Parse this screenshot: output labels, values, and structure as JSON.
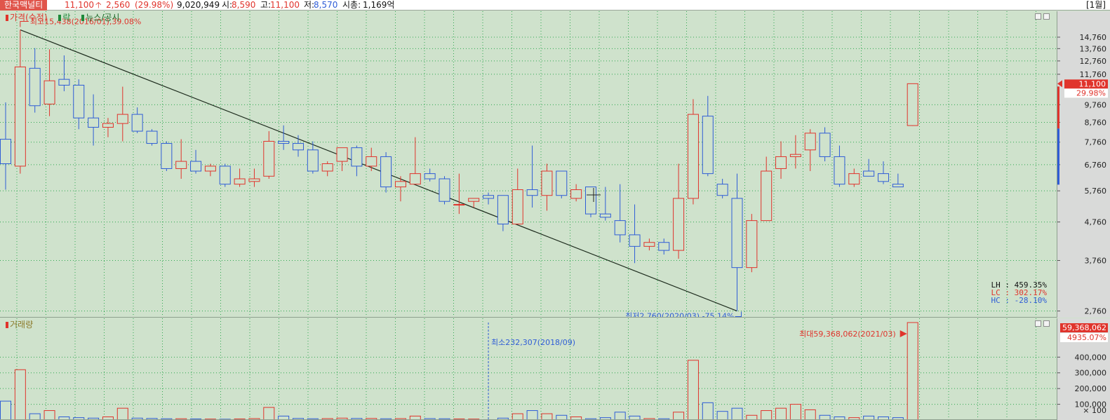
{
  "top_bar": {
    "name": "한국맥널티",
    "price": "11,100",
    "change_icon": "up-arrow-icon",
    "change": "2,560",
    "change_pct": "(29.98%)",
    "volume": "9,020,949",
    "open_label": "시:",
    "open_value": "8,590",
    "high_label": "고:",
    "high_value": "11,100",
    "low_label": "저:",
    "low_value": "8,570",
    "mcap_label": "시총:",
    "mcap_value": "1,169억",
    "timeframe": "[1월]"
  },
  "price_panel": {
    "legend": [
      "가격(수정)",
      "락",
      "뉴스/공시"
    ],
    "high_annotation": "최고15,438(2016/01),39.08%",
    "low_annotation": "최저2,760(2020/03),-75.14%",
    "stats": {
      "lh": "LH : 459.35%",
      "lc": "LC : 302.17%",
      "hc": "HC : -28.10%"
    },
    "last_price_tag": "11,100",
    "last_pct_tag": "29.98%"
  },
  "volume_panel": {
    "legend": "거래량",
    "min_annotation": "최소232,307(2018/09)",
    "max_annotation": "최대59,368,062(2021/03)",
    "max_tag": "59,368,062",
    "pct_tag": "4935.07%",
    "axis_unit": "× 100"
  },
  "colors": {
    "up": "#e0342c",
    "down": "#2f5dd6",
    "background": "#cfe2cc",
    "grid": "#2fa84f"
  },
  "chart_data": [
    {
      "type": "candlestick",
      "title": "가격(수정)",
      "interval": "monthly",
      "y_ticks": [
        14760,
        13760,
        12760,
        11760,
        9760,
        8760,
        7760,
        6760,
        5760,
        4760,
        3760,
        2760
      ],
      "y_tick_labels": [
        "14,760",
        "13,760",
        "12,760",
        "11,760",
        "9,760",
        "8,760",
        "7,760",
        "6,760",
        "5,760",
        "4,760",
        "3,760",
        "2,760"
      ],
      "y_scale": "log",
      "ylim": [
        2650,
        17300
      ],
      "high": {
        "value": 15438,
        "date": "2016/01",
        "pct": 39.08
      },
      "low": {
        "value": 2760,
        "date": "2020/03",
        "pct": -75.14
      },
      "trendline": {
        "from": {
          "index": 1,
          "value": 15438
        },
        "to": {
          "index": 50,
          "value": 2760
        }
      },
      "candles": [
        {
          "o": 7900,
          "h": 9900,
          "l": 5800,
          "c": 6800
        },
        {
          "o": 6700,
          "h": 15438,
          "l": 6400,
          "c": 12300
        },
        {
          "o": 12200,
          "h": 13800,
          "l": 9300,
          "c": 9700
        },
        {
          "o": 9800,
          "h": 13700,
          "l": 9100,
          "c": 11300
        },
        {
          "o": 11400,
          "h": 13200,
          "l": 10600,
          "c": 11000
        },
        {
          "o": 11000,
          "h": 11400,
          "l": 8400,
          "c": 9000
        },
        {
          "o": 9000,
          "h": 10400,
          "l": 7600,
          "c": 8500
        },
        {
          "o": 8500,
          "h": 9000,
          "l": 8000,
          "c": 8700
        },
        {
          "o": 8700,
          "h": 10900,
          "l": 7800,
          "c": 9200
        },
        {
          "o": 9200,
          "h": 9600,
          "l": 8200,
          "c": 8300
        },
        {
          "o": 8300,
          "h": 8400,
          "l": 7600,
          "c": 7700
        },
        {
          "o": 7700,
          "h": 7800,
          "l": 6500,
          "c": 6600
        },
        {
          "o": 6600,
          "h": 7900,
          "l": 6200,
          "c": 6900
        },
        {
          "o": 6900,
          "h": 7400,
          "l": 6400,
          "c": 6500
        },
        {
          "o": 6500,
          "h": 6800,
          "l": 6300,
          "c": 6700
        },
        {
          "o": 6700,
          "h": 6800,
          "l": 5900,
          "c": 6000
        },
        {
          "o": 6000,
          "h": 6600,
          "l": 5900,
          "c": 6200
        },
        {
          "o": 6100,
          "h": 6600,
          "l": 5900,
          "c": 6200
        },
        {
          "o": 6300,
          "h": 8300,
          "l": 6200,
          "c": 7800
        },
        {
          "o": 7800,
          "h": 8600,
          "l": 7400,
          "c": 7700
        },
        {
          "o": 7700,
          "h": 8100,
          "l": 7100,
          "c": 7400
        },
        {
          "o": 7400,
          "h": 7800,
          "l": 6400,
          "c": 6500
        },
        {
          "o": 6500,
          "h": 6900,
          "l": 6300,
          "c": 6800
        },
        {
          "o": 6900,
          "h": 7500,
          "l": 6500,
          "c": 7500
        },
        {
          "o": 7500,
          "h": 7600,
          "l": 6300,
          "c": 6700
        },
        {
          "o": 6700,
          "h": 7500,
          "l": 6500,
          "c": 7100
        },
        {
          "o": 7100,
          "h": 7300,
          "l": 5700,
          "c": 5900
        },
        {
          "o": 5900,
          "h": 6300,
          "l": 5400,
          "c": 6100
        },
        {
          "o": 6000,
          "h": 8000,
          "l": 6000,
          "c": 6400
        },
        {
          "o": 6400,
          "h": 6600,
          "l": 6100,
          "c": 6200
        },
        {
          "o": 6200,
          "h": 6300,
          "l": 5300,
          "c": 5400
        },
        {
          "o": 5300,
          "h": 6400,
          "l": 5000,
          "c": 5300
        },
        {
          "o": 5400,
          "h": 5500,
          "l": 5200,
          "c": 5500
        },
        {
          "o": 5600,
          "h": 5700,
          "l": 5300,
          "c": 5500
        },
        {
          "o": 5600,
          "h": 5600,
          "l": 4500,
          "c": 4700
        },
        {
          "o": 4700,
          "h": 6600,
          "l": 4700,
          "c": 5800
        },
        {
          "o": 5800,
          "h": 7600,
          "l": 5200,
          "c": 5600
        },
        {
          "o": 5600,
          "h": 6800,
          "l": 5100,
          "c": 6500
        },
        {
          "o": 6500,
          "h": 6500,
          "l": 5500,
          "c": 5600
        },
        {
          "o": 5500,
          "h": 6000,
          "l": 5400,
          "c": 5800
        },
        {
          "o": 5900,
          "h": 5900,
          "l": 4900,
          "c": 5000
        },
        {
          "o": 5000,
          "h": 5900,
          "l": 4800,
          "c": 4900
        },
        {
          "o": 4800,
          "h": 6000,
          "l": 4200,
          "c": 4400
        },
        {
          "o": 4400,
          "h": 5300,
          "l": 3700,
          "c": 4100
        },
        {
          "o": 4100,
          "h": 4300,
          "l": 4000,
          "c": 4200
        },
        {
          "o": 4200,
          "h": 4300,
          "l": 3900,
          "c": 4000
        },
        {
          "o": 4000,
          "h": 6800,
          "l": 3800,
          "c": 5500
        },
        {
          "o": 5500,
          "h": 10100,
          "l": 5300,
          "c": 9200
        },
        {
          "o": 9100,
          "h": 10300,
          "l": 6300,
          "c": 6400
        },
        {
          "o": 6000,
          "h": 6200,
          "l": 5500,
          "c": 5600
        },
        {
          "o": 5500,
          "h": 6400,
          "l": 2760,
          "c": 3600
        },
        {
          "o": 3600,
          "h": 5000,
          "l": 3500,
          "c": 4800
        },
        {
          "o": 4800,
          "h": 7100,
          "l": 4800,
          "c": 6500
        },
        {
          "o": 6600,
          "h": 7800,
          "l": 6200,
          "c": 7100
        },
        {
          "o": 7100,
          "h": 8100,
          "l": 6600,
          "c": 7200
        },
        {
          "o": 7400,
          "h": 8400,
          "l": 6500,
          "c": 8200
        },
        {
          "o": 8200,
          "h": 8500,
          "l": 6900,
          "c": 7100
        },
        {
          "o": 7100,
          "h": 7600,
          "l": 5900,
          "c": 6000
        },
        {
          "o": 6000,
          "h": 6600,
          "l": 5900,
          "c": 6400
        },
        {
          "o": 6500,
          "h": 7000,
          "l": 6300,
          "c": 6300
        },
        {
          "o": 6400,
          "h": 6900,
          "l": 6000,
          "c": 6100
        },
        {
          "o": 6000,
          "h": 6400,
          "l": 5900,
          "c": 5900
        },
        {
          "o": 8590,
          "h": 11100,
          "l": 8570,
          "c": 11100
        }
      ]
    },
    {
      "type": "bar",
      "title": "거래량",
      "unit": "× 100",
      "y_ticks": [
        100000,
        200000,
        300000,
        400000
      ],
      "y_tick_labels": [
        "100,000",
        "200,000",
        "300,000",
        "400,000"
      ],
      "ylim": [
        0,
        620000
      ],
      "max": {
        "value": 59368062,
        "date": "2021/03"
      },
      "min": {
        "value": 232307,
        "date": "2018/09",
        "index": 33
      },
      "values": [
        120000,
        320000,
        40000,
        60000,
        20000,
        15000,
        12000,
        20000,
        75000,
        12000,
        10000,
        8000,
        8000,
        7000,
        6000,
        5000,
        7000,
        9000,
        80000,
        25000,
        10000,
        8000,
        9000,
        12000,
        10000,
        10000,
        8000,
        9000,
        25000,
        9000,
        8000,
        7000,
        6000,
        2323,
        12000,
        40000,
        60000,
        40000,
        30000,
        20000,
        8000,
        15000,
        50000,
        25000,
        9000,
        8000,
        50000,
        380000,
        110000,
        55000,
        75000,
        30000,
        60000,
        75000,
        100000,
        65000,
        30000,
        20000,
        15000,
        25000,
        20000,
        15000,
        620000
      ]
    }
  ]
}
